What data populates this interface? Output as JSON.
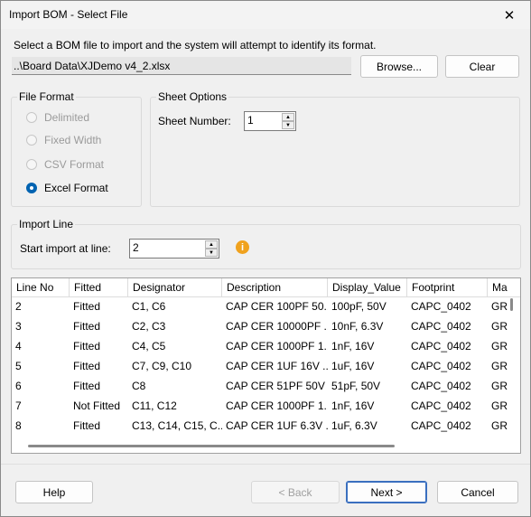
{
  "window": {
    "title": "Import BOM - Select File",
    "close_glyph": "✕"
  },
  "instruction": "Select a BOM file to import and the system will attempt to identify its format.",
  "file": {
    "path": "..\\Board Data\\XJDemo v4_2.xlsx",
    "browse_label": "Browse...",
    "clear_label": "Clear"
  },
  "file_format": {
    "title": "File Format",
    "options": [
      {
        "label": "Delimited",
        "selected": false,
        "enabled": false
      },
      {
        "label": "Fixed Width",
        "selected": false,
        "enabled": false
      },
      {
        "label": "CSV Format",
        "selected": false,
        "enabled": false
      },
      {
        "label": "Excel Format",
        "selected": true,
        "enabled": true
      }
    ]
  },
  "sheet_options": {
    "title": "Sheet Options",
    "sheet_number_label": "Sheet Number:",
    "sheet_number": "1"
  },
  "import_line": {
    "title": "Import Line",
    "start_label": "Start import at line:",
    "start_value": "2",
    "info_icon": "info-icon"
  },
  "grid": {
    "columns": [
      "Line No",
      "Fitted",
      "Designator",
      "Description",
      "Display_Value",
      "Footprint",
      "Ma"
    ],
    "rows": [
      [
        "2",
        "Fitted",
        "C1, C6",
        "CAP CER 100PF 50...",
        "100pF, 50V",
        "CAPC_0402",
        "GR"
      ],
      [
        "3",
        "Fitted",
        "C2, C3",
        "CAP CER 10000PF ...",
        "10nF, 6.3V",
        "CAPC_0402",
        "GR"
      ],
      [
        "4",
        "Fitted",
        "C4, C5",
        "CAP CER 1000PF 1...",
        "1nF, 16V",
        "CAPC_0402",
        "GR"
      ],
      [
        "5",
        "Fitted",
        "C7, C9, C10",
        "CAP CER 1UF 16V ...",
        "1uF, 16V",
        "CAPC_0402",
        "GR"
      ],
      [
        "6",
        "Fitted",
        "C8",
        "CAP CER 51PF 50V ...",
        "51pF, 50V",
        "CAPC_0402",
        "GR"
      ],
      [
        "7",
        "Not Fitted",
        "C11, C12",
        "CAP CER 1000PF 1...",
        "1nF, 16V",
        "CAPC_0402",
        "GR"
      ],
      [
        "8",
        "Fitted",
        "C13, C14, C15, C...",
        "CAP CER 1UF 6.3V ...",
        "1uF, 6.3V",
        "CAPC_0402",
        "GR"
      ]
    ]
  },
  "footer": {
    "help_label": "Help",
    "back_label": "< Back",
    "next_label": "Next >",
    "cancel_label": "Cancel"
  },
  "colors": {
    "accent": "#0063b1",
    "info": "#f0a21e"
  }
}
